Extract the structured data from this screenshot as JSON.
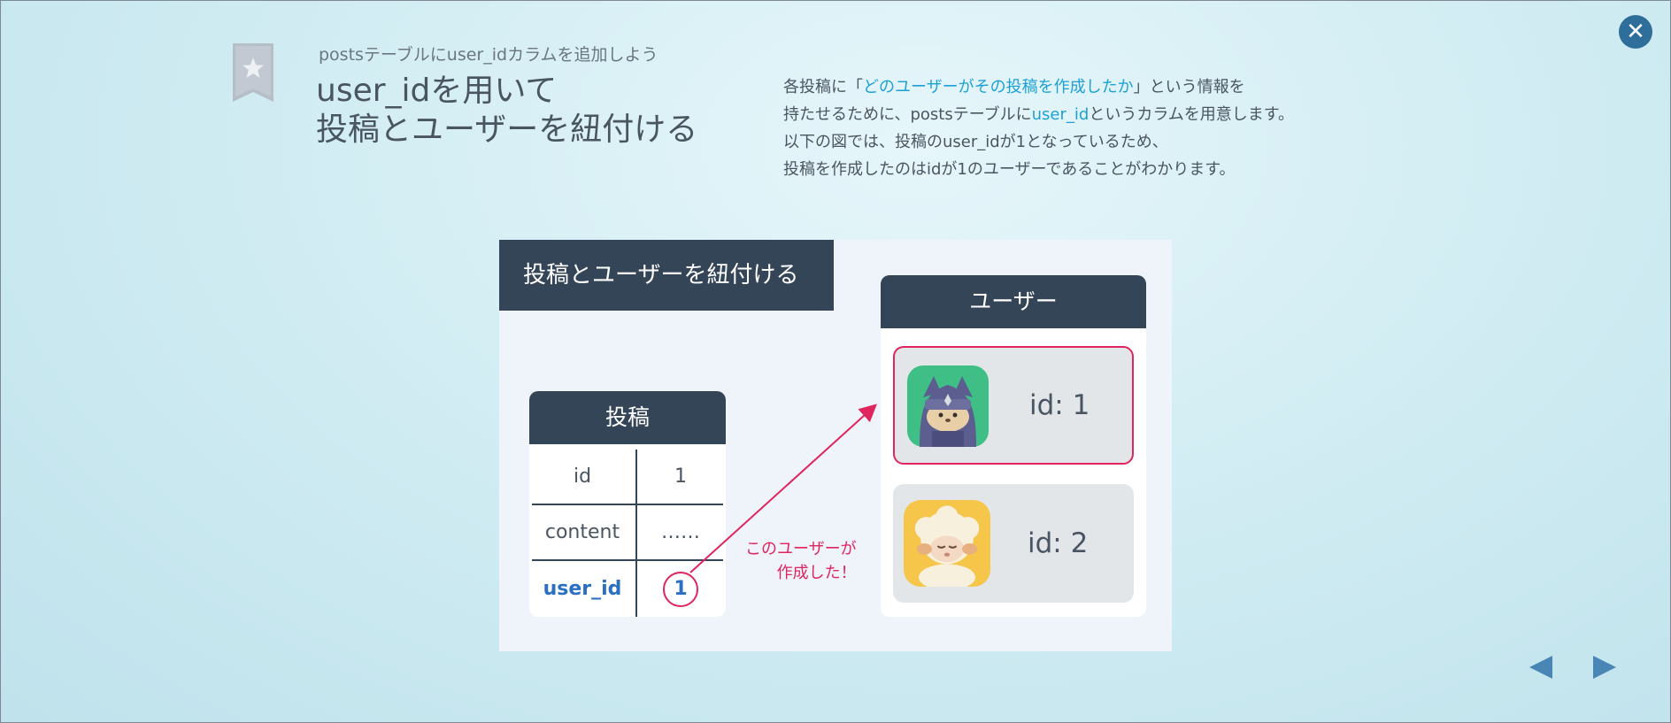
{
  "header": {
    "subtitle": "postsテーブルにuser_idカラムを追加しよう",
    "title": "user_idを用いて\n投稿とユーザーを紐付ける"
  },
  "description": {
    "line1_pre": "各投稿に「",
    "line1_hl": "どのユーザーがその投稿を作成したか",
    "line1_post": "」という情報を",
    "line2_pre": "持たせるために、postsテーブルに",
    "line2_hl": "user_id",
    "line2_post": "というカラムを用意します。",
    "line3": "以下の図では、投稿のuser_idが1となっているため、",
    "line4": "投稿を作成したのはidが1のユーザーであることがわかります。"
  },
  "diagram": {
    "title": "投稿とユーザーを紐付ける",
    "posts_header": "投稿",
    "rows": [
      {
        "key": "id",
        "value": "1"
      },
      {
        "key": "content",
        "value": "……"
      },
      {
        "key": "user_id",
        "value": "1"
      }
    ],
    "annotation_line1": "このユーザーが",
    "annotation_line2": "作成した！",
    "users_header": "ユーザー",
    "users": [
      {
        "label": "id: 1",
        "avatar": "ninja-cat-icon"
      },
      {
        "label": "id: 2",
        "avatar": "sheep-icon"
      }
    ]
  },
  "icons": {
    "close": "close-icon",
    "bookmark": "star-bookmark-icon",
    "prev": "prev-arrow-icon",
    "next": "next-arrow-icon"
  },
  "colors": {
    "dark_header": "#354558",
    "accent_pink": "#e0245e",
    "highlight_blue": "#1da0d6",
    "user_id_blue": "#2a6fc1"
  }
}
